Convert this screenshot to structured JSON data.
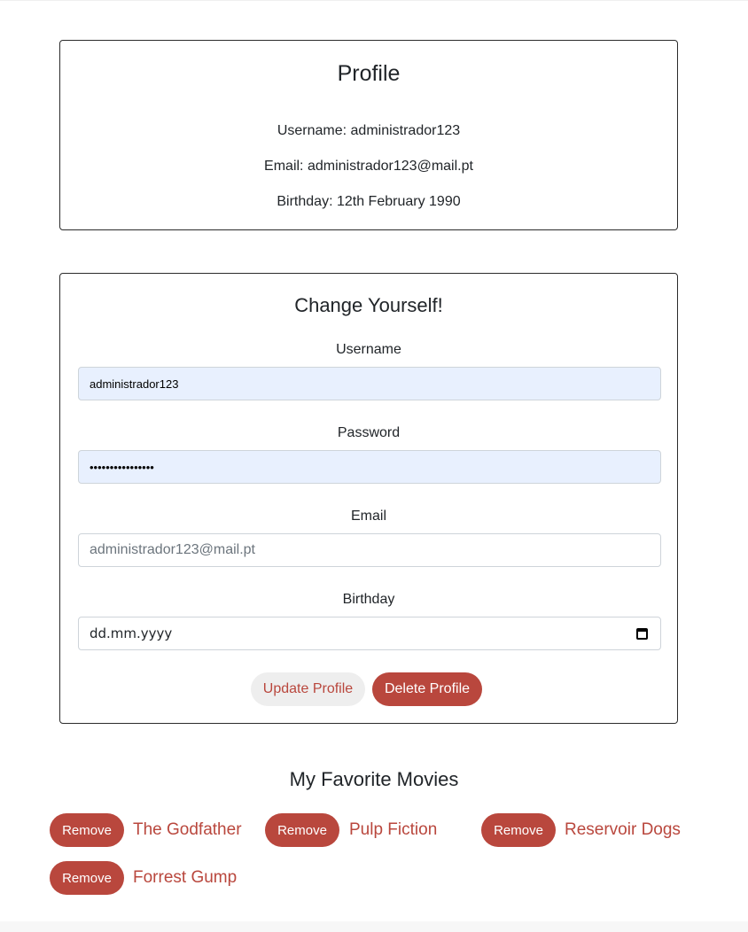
{
  "profile": {
    "title": "Profile",
    "username_line": "Username: administrador123",
    "email_line": "Email: administrador123@mail.pt",
    "birthday_line": "Birthday: 12th February 1990"
  },
  "edit_form": {
    "title": "Change Yourself!",
    "username_label": "Username",
    "username_value": "administrador123",
    "password_label": "Password",
    "password_value": "••••••••••••••••",
    "email_label": "Email",
    "email_placeholder": "administrador123@mail.pt",
    "birthday_label": "Birthday",
    "birthday_placeholder": "dd.mm.yyyy",
    "update_label": "Update Profile",
    "delete_label": "Delete Profile"
  },
  "favorites": {
    "title": "My Favorite Movies",
    "remove_label": "Remove",
    "movies": [
      "The Godfather",
      "Pulp Fiction",
      "Reservoir Dogs",
      "Forrest Gump"
    ]
  },
  "colors": {
    "accent": "#b9473d",
    "autofill_bg": "#e8f0fe"
  }
}
